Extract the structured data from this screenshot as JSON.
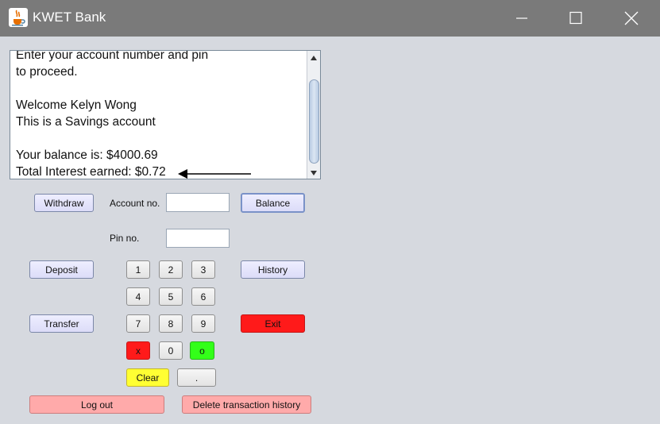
{
  "window": {
    "title": "KWET Bank",
    "icon": "java-cup-icon",
    "controls": [
      "minimize-icon",
      "maximize-icon",
      "close-icon"
    ]
  },
  "output": {
    "lines": [
      "Enter your account number and pin",
      "to proceed.",
      "",
      "Welcome Kelyn Wong",
      "This is a Savings account",
      "",
      "Your balance is: $4000.69",
      "Total Interest earned: $0.72"
    ]
  },
  "actions": {
    "withdraw": "Withdraw",
    "deposit": "Deposit",
    "transfer": "Transfer",
    "balance": "Balance",
    "history": "History",
    "exit": "Exit",
    "logout": "Log out",
    "delete_history": "Delete transaction history"
  },
  "form": {
    "account_label": "Account no.",
    "account_value": "",
    "pin_label": "Pin no.",
    "pin_value": ""
  },
  "keypad": {
    "digits": [
      "1",
      "2",
      "3",
      "4",
      "5",
      "6",
      "7",
      "8",
      "9",
      "0"
    ],
    "cancel": "x",
    "ok": "o",
    "clear": "Clear",
    "dot": "."
  },
  "colors": {
    "titlebar": "#7a7a7a",
    "cancel": "#ff1a1a",
    "ok": "#33ff19",
    "clear": "#ffff33",
    "pink": "#ffaaaa",
    "lavender": "#e6e6fa"
  }
}
